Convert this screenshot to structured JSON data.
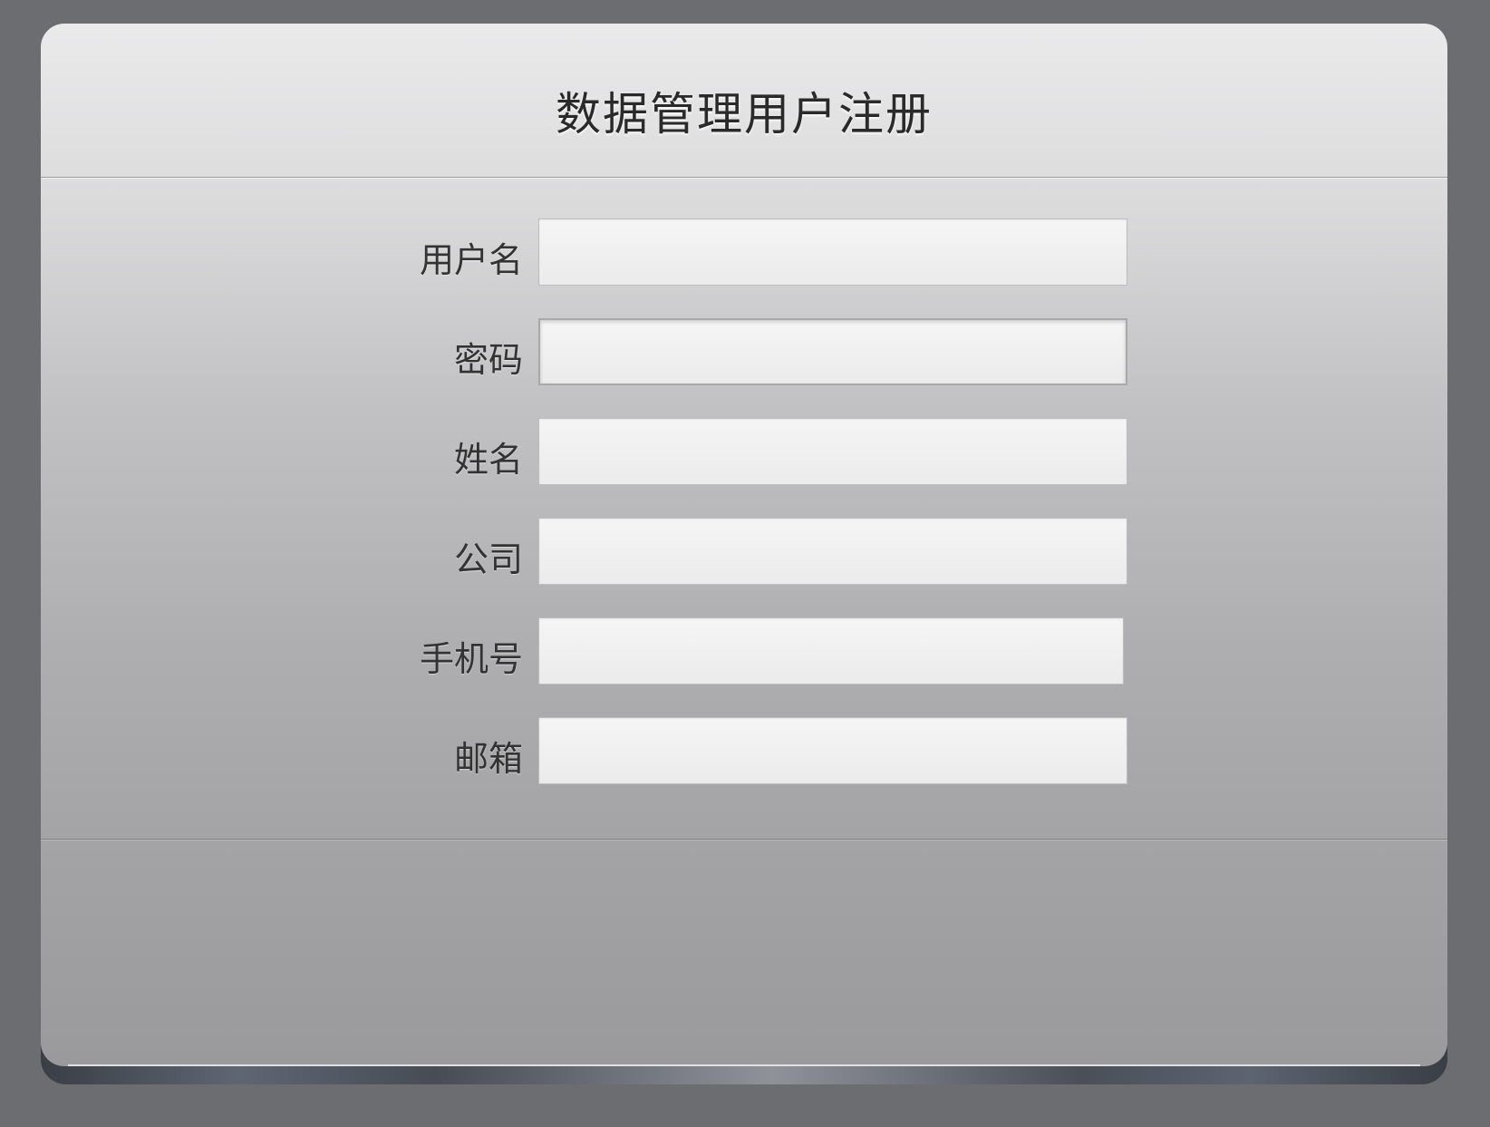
{
  "form": {
    "title": "数据管理用户注册",
    "fields": [
      {
        "label": "用户名",
        "value": "",
        "placeholder": ""
      },
      {
        "label": "密码",
        "value": "",
        "placeholder": ""
      },
      {
        "label": "姓名",
        "value": "",
        "placeholder": ""
      },
      {
        "label": "公司",
        "value": "",
        "placeholder": ""
      },
      {
        "label": "手机号",
        "value": "",
        "placeholder": ""
      },
      {
        "label": "邮箱",
        "value": "",
        "placeholder": ""
      }
    ]
  },
  "colors": {
    "background": "#6c6d71",
    "panel_top": "#eaeaeb",
    "panel_bottom": "#9a9a9c",
    "title_text": "#2a2a2a",
    "label_text": "#333333",
    "input_background": "#f2f2f2"
  }
}
